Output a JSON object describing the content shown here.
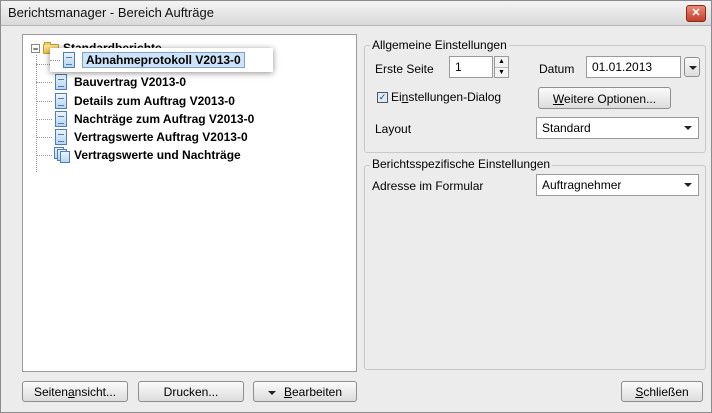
{
  "window": {
    "title": "Berichtsmanager - Bereich Aufträge",
    "close_glyph": "✕"
  },
  "tree": {
    "root_label": "Standardberichte",
    "items": [
      {
        "label": "Abnahmeprotokoll V2013-0",
        "icon": "document-icon",
        "selected": true
      },
      {
        "label": "Bauvertrag V2013-0",
        "icon": "document-icon"
      },
      {
        "label": "Details zum Auftrag V2013-0",
        "icon": "document-icon"
      },
      {
        "label": "Nachträge zum Auftrag V2013-0",
        "icon": "document-icon"
      },
      {
        "label": "Vertragswerte Auftrag V2013-0",
        "icon": "document-icon"
      },
      {
        "label": "Vertragswerte und Nachträge",
        "icon": "document-stack-icon"
      }
    ]
  },
  "general": {
    "title": "Allgemeine Einstellungen",
    "first_page_label": "Erste Seite",
    "first_page_value": "1",
    "date_label": "Datum",
    "date_value": "01.01.2013",
    "settings_dialog_label_pre": "Ei",
    "settings_dialog_label_mn": "n",
    "settings_dialog_label_post": "stellungen-Dialog",
    "settings_dialog_checked": true,
    "more_options_mn": "W",
    "more_options_rest": "eitere Optionen...",
    "layout_label": "Layout",
    "layout_value": "Standard"
  },
  "specific": {
    "title": "Berichtsspezifische Einstellungen",
    "address_label": "Adresse im Formular",
    "address_value": "Auftragnehmer"
  },
  "footer": {
    "preview_pre": "Seiten",
    "preview_mn": "a",
    "preview_post": "nsicht...",
    "print_label": "Drucken...",
    "edit_mn": "B",
    "edit_rest": "earbeiten",
    "close_mn": "S",
    "close_rest": "chließen"
  }
}
